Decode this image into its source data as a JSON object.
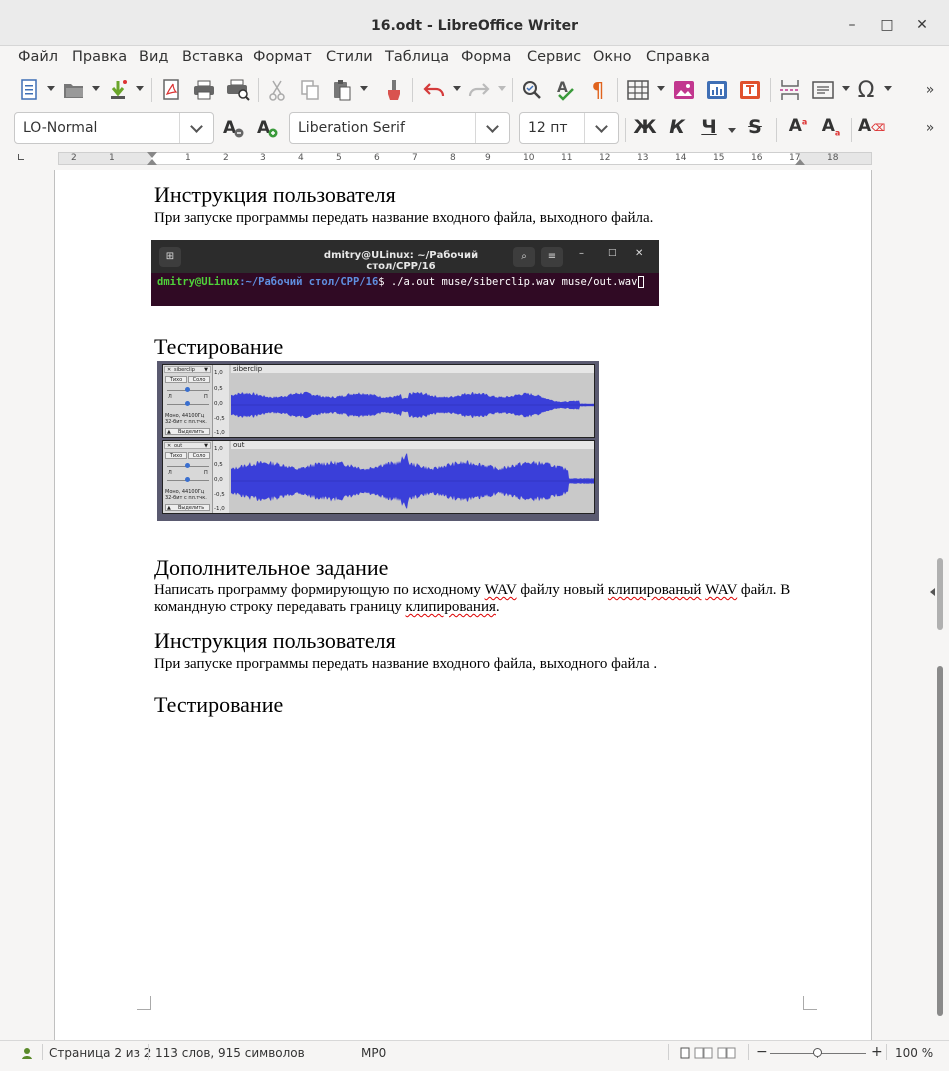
{
  "window": {
    "title": "16.odt - LibreOffice Writer",
    "minimize": "–",
    "maximize": "□",
    "close": "✕"
  },
  "menu": [
    "Файл",
    "Правка",
    "Вид",
    "Вставка",
    "Формат",
    "Стили",
    "Таблица",
    "Форма",
    "Сервис",
    "Окно",
    "Справка"
  ],
  "toolbar2": {
    "paragraph_style": "LO-Normal",
    "font_name": "Liberation Serif",
    "font_size": "12 пт",
    "bold": "Ж",
    "italic": "К",
    "underline": "Ч",
    "strike": "S",
    "superscript": "A",
    "subscript": "A",
    "clear": "A"
  },
  "ruler": {
    "labels": [
      "2",
      "1",
      "1",
      "2",
      "3",
      "4",
      "5",
      "6",
      "7",
      "8",
      "9",
      "10",
      "11",
      "12",
      "13",
      "14",
      "15",
      "16",
      "17",
      "18"
    ]
  },
  "document": {
    "heading_user_guide_1": "Инструкция пользователя",
    "para_user_guide_1": "При запуске программы передать название входного файла, выходного файла.",
    "terminal": {
      "title": "dmitry@ULinux: ~/Рабочий стол/CPP/16",
      "prompt_user": "dmitry@ULinux",
      "prompt_path": ":~/Рабочий стол/CPP/16",
      "command": "$ ./a.out muse/siberclip.wav muse/out.wav"
    },
    "heading_testing_1": "Тестирование",
    "audacity": {
      "track1_name": "siberclip",
      "track2_name": "out",
      "mute": "Тихо",
      "solo": "Соло",
      "info1": "Моно, 44100Гц",
      "info2": "32-бит с пл.тчк.",
      "select": "Выделить",
      "scale": [
        "1,0",
        "0,5",
        "0,0",
        "-0,5",
        "-1,0"
      ],
      "l": "Л",
      "p": "П"
    },
    "heading_extra": "Дополнительное задание",
    "para_extra_part1": "Написать программу  формирующую  по исходному ",
    "para_extra_wav1": "WAV",
    "para_extra_part2": " файлу  новый ",
    "para_extra_clipped": "клипированый",
    "para_extra_space": " ",
    "para_extra_wav2": "WAV",
    "para_extra_part3": " файл. В командную строку передавать границу ",
    "para_extra_clipping": "клипирования",
    "para_extra_end": ".",
    "heading_user_guide_2": "Инструкция пользователя",
    "para_user_guide_2": "При запуске программы передать название входного файла, выходного файла .",
    "heading_testing_2": "Тестирование"
  },
  "statusbar": {
    "page": "Страница 2 из 2",
    "words": "113 слов, 915 символов",
    "macro": "MP0",
    "zoom": "100 %",
    "zoom_minus": "−",
    "zoom_plus": "+"
  },
  "colors": {
    "waveform": "#3a3fd9",
    "terminal_bg": "#300a24",
    "prompt_green": "#4fd13a",
    "prompt_blue": "#5f8fe0"
  }
}
